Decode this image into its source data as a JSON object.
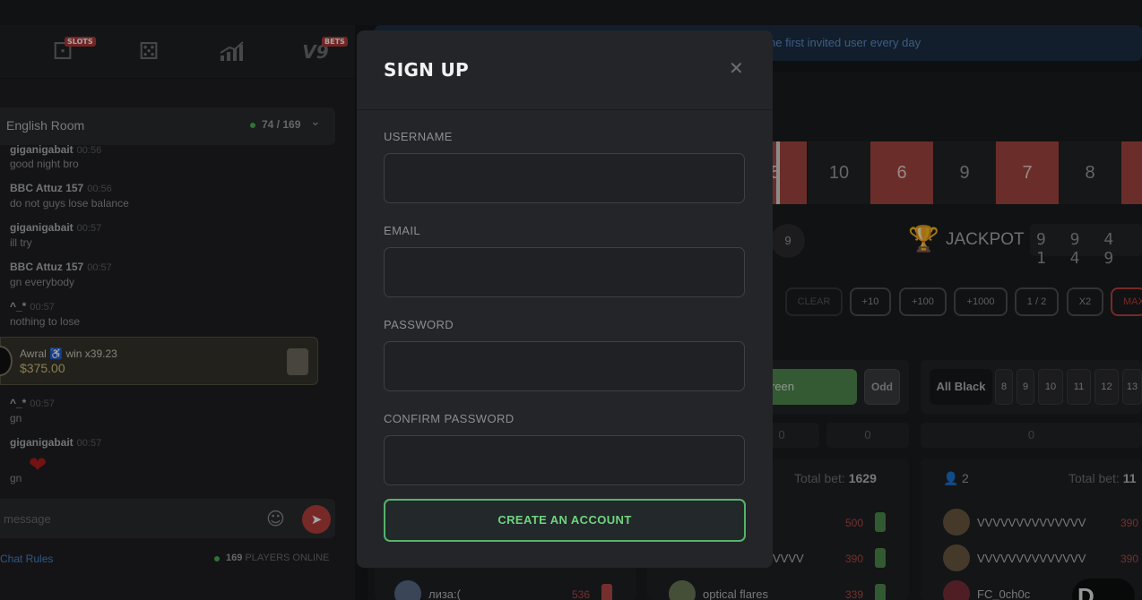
{
  "game_nav": {
    "slots_badge": "SLOTS",
    "bets_badge": "BETS",
    "bets_logo": "V9"
  },
  "chat": {
    "room_name": "English Room",
    "room_count": "74 / 169",
    "messages": [
      {
        "name": "giganigabait",
        "time": "00:56",
        "text": "good night bro"
      },
      {
        "name": "BBC Attuz 157",
        "time": "00:56",
        "text": "do not guys lose balance"
      },
      {
        "name": "giganigabait",
        "time": "00:57",
        "text": "ill try"
      },
      {
        "name": "BBC Attuz 157",
        "time": "00:57",
        "text": "gn everybody"
      },
      {
        "name": "^_*",
        "time": "00:57",
        "text": "nothing to lose"
      },
      {
        "name": "^_*",
        "time": "00:57",
        "text": "gn"
      },
      {
        "name": "giganigabait",
        "time": "00:57",
        "text": "gn"
      }
    ],
    "win": {
      "name": "Awral",
      "multiplier": "win x39.23",
      "amount": "$375.00"
    },
    "input_placeholder": "message",
    "rules_link": "Chat Rules",
    "players_online_count": "169",
    "players_online_label": "PLAYERS ONLINE"
  },
  "notice": {
    "text": "he first invited user every day"
  },
  "roulette": {
    "cells": [
      {
        "value": "5",
        "color": "red"
      },
      {
        "value": "10",
        "color": "dark"
      },
      {
        "value": "6",
        "color": "red"
      },
      {
        "value": "9",
        "color": "dark"
      },
      {
        "value": "7",
        "color": "red"
      },
      {
        "value": "8",
        "color": "dark"
      },
      {
        "value": "",
        "color": "red"
      }
    ],
    "last_roll": "9",
    "jackpot_label": "JACKPOT",
    "jackpot_digits": "9 9 4 1 4 9"
  },
  "bet_controls": {
    "chips": [
      "CLEAR",
      "+10",
      "+100",
      "+1000",
      "1 / 2",
      "X2",
      "MAX"
    ]
  },
  "bet_panels": {
    "green_label": "reen",
    "odd_label": "Odd",
    "all_black_label": "All Black",
    "numbers": [
      "8",
      "9",
      "10",
      "11",
      "12",
      "13"
    ],
    "zero_a": "0",
    "zero_b": "0",
    "zero_c": "0"
  },
  "players": {
    "middle_total_label": "Total bet:",
    "middle_total_value": "1629",
    "right_count": "2",
    "right_total_label": "Total bet:",
    "right_total_value": "11",
    "middle_rows": [
      {
        "name": "",
        "amount": "500"
      },
      {
        "name": "VVVV",
        "amount": "390"
      },
      {
        "name": "optical flares",
        "amount": "339"
      }
    ],
    "left_rows": [
      {
        "name": "лиза:(",
        "amount": "536"
      }
    ],
    "right_rows": [
      {
        "name": "VVVVVVVVVVVVVV",
        "amount": "390"
      },
      {
        "name": "VVVVVVVVVVVVVV",
        "amount": "390"
      },
      {
        "name": "FC_0ch0c",
        "amount": ""
      }
    ],
    "corner_button": "D"
  },
  "modal": {
    "title": "SIGN UP",
    "close_icon": "close-icon",
    "username_label": "USERNAME",
    "username_value": "",
    "email_label": "EMAIL",
    "email_value": "",
    "password_label": "PASSWORD",
    "password_value": "",
    "confirm_label": "CONFIRM PASSWORD",
    "confirm_value": "",
    "submit_label": "CREATE AN ACCOUNT",
    "accent_color": "#55b36a"
  }
}
